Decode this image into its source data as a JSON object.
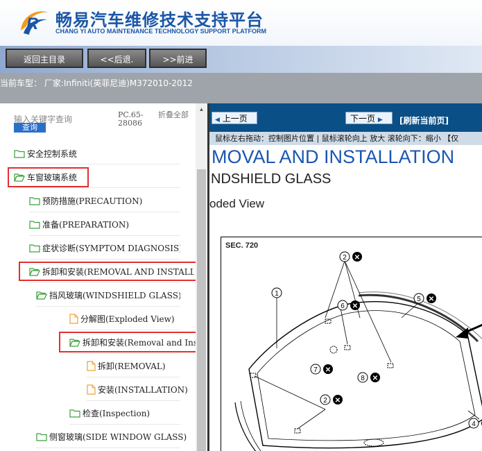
{
  "header": {
    "title_cn": "畅易汽车维修技术支持平台",
    "title_en": "CHANG YI AUTO MAINTENANCE TECHNOLOGY SUPPORT PLATFORM",
    "logo_icon": "cy-logo-icon"
  },
  "nav": {
    "home": "返回主目录",
    "back": "<<后退.",
    "forward": ">>前进"
  },
  "vehicle": {
    "text": "当前车型： 厂家:Infiniti(英菲尼迪)M372010-2012"
  },
  "sidebar": {
    "search_placeholder": "输入关键字查询",
    "search_button": "查询",
    "pc_code": "PC.65-28086",
    "collapse_all": "折叠全部",
    "items": [
      {
        "label": "安全控制系统",
        "icon": "folder-icon"
      },
      {
        "label": "车窗玻璃系统",
        "icon": "folder-open-icon"
      },
      {
        "label": "预防措施(PRECAUTION)",
        "icon": "folder-icon"
      },
      {
        "label": "准备(PREPARATION)",
        "icon": "folder-icon"
      },
      {
        "label": "症状诊断(SYMPTOM DIAGNOSIS)",
        "icon": "folder-icon"
      },
      {
        "label": "拆卸和安装(REMOVAL AND INSTALLATION)",
        "icon": "folder-open-icon"
      },
      {
        "label": "挡风玻璃(WINDSHIELD GLASS)",
        "icon": "folder-open-icon"
      },
      {
        "label": "分解图(Exploded View)",
        "icon": "document-icon"
      },
      {
        "label": "拆卸和安装(Removal and Installation)",
        "icon": "folder-open-icon"
      },
      {
        "label": "拆卸(REMOVAL)",
        "icon": "document-icon"
      },
      {
        "label": "安装(INSTALLATION)",
        "icon": "document-icon"
      },
      {
        "label": "检查(Inspection)",
        "icon": "folder-icon"
      },
      {
        "label": "侧窗玻璃(SIDE WINDOW GLASS)",
        "icon": "folder-icon"
      }
    ]
  },
  "viewer": {
    "prev": "上一页",
    "next": "下一页",
    "refresh": "[刷新当前页]",
    "hint": "鼠标左右拖动：控制图片位置 | 鼠标滚轮向上 放大  滚轮向下：缩小 【仅",
    "doc_title": "MOVAL AND INSTALLATION",
    "doc_subtitle": "NDSHIELD GLASS",
    "doc_section": "oded View",
    "sec_label": "SEC. 720",
    "callouts": [
      "1",
      "2",
      "5",
      "6",
      "7",
      "8",
      "2",
      "4"
    ]
  },
  "colors": {
    "brand_blue": "#1a56a6",
    "toolbar_blue": "#0a4f86",
    "highlight_red": "#e03030"
  }
}
